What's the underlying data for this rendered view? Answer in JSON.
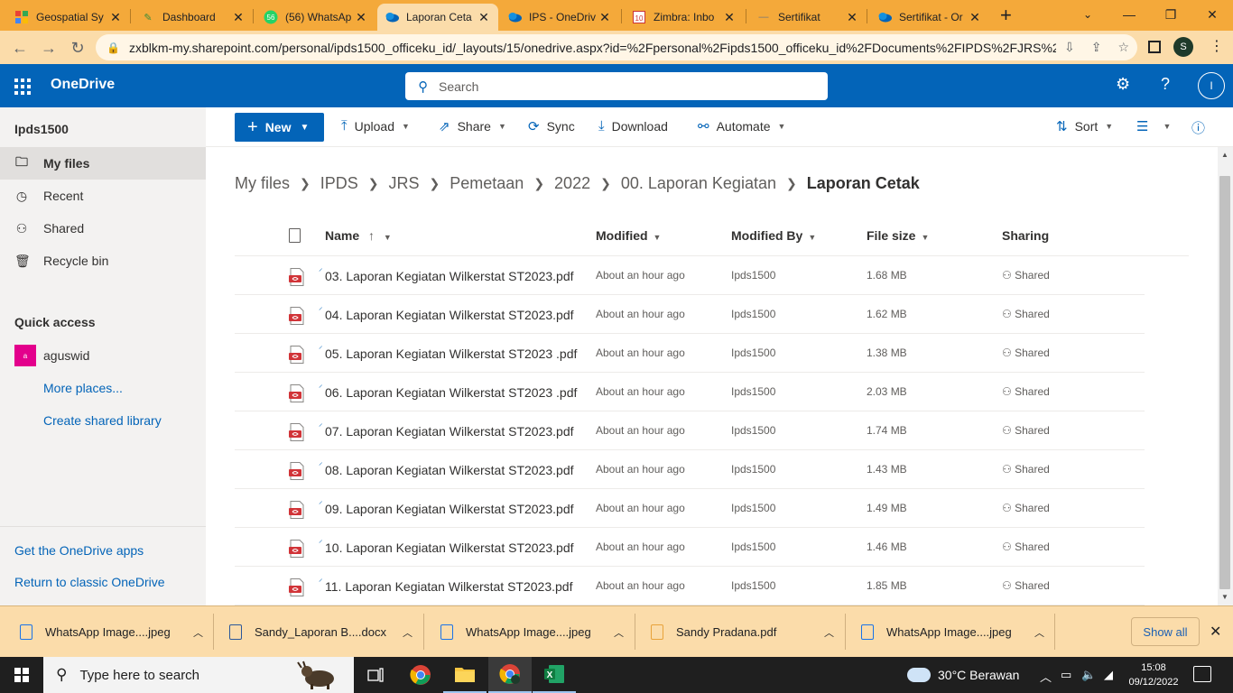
{
  "browser": {
    "tabs": [
      {
        "title": "Geospatial Sy",
        "icon": "geospatial-favicon"
      },
      {
        "title": "Dashboard",
        "icon": "dashboard-favicon"
      },
      {
        "title": "(56) WhatsAp",
        "icon": "whatsapp-favicon",
        "badge": "56"
      },
      {
        "title": "Laporan Ceta",
        "icon": "onedrive-favicon",
        "active": true
      },
      {
        "title": "IPS - OneDriv",
        "icon": "onedrive-favicon"
      },
      {
        "title": "Zimbra: Inbo",
        "icon": "zimbra-favicon"
      },
      {
        "title": "Sertifikat",
        "icon": "blank-favicon"
      },
      {
        "title": "Sertifikat - Or",
        "icon": "onedrive-favicon"
      }
    ],
    "url": "zxblkm-my.sharepoint.com/personal/ipds1500_officeku_id/_layouts/15/onedrive.aspx?id=%2Fpersonal%2Fipds1500_officeku_id%2FDocuments%2FIPDS%2FJRS%2...",
    "profile_initial": "S"
  },
  "suite": {
    "app_name": "OneDrive",
    "search_placeholder": "Search",
    "user_initial": "I"
  },
  "leftnav": {
    "account": "Ipds1500",
    "items": [
      {
        "label": "My files",
        "icon": "folder-icon",
        "selected": true
      },
      {
        "label": "Recent",
        "icon": "clock-icon"
      },
      {
        "label": "Shared",
        "icon": "people-icon"
      },
      {
        "label": "Recycle bin",
        "icon": "recycle-bin-icon"
      }
    ],
    "quick_access_title": "Quick access",
    "quick_access_user": "aguswid",
    "quick_access_avatar": "a",
    "more_places": "More places...",
    "create_library": "Create shared library",
    "get_apps": "Get the OneDrive apps",
    "return_classic": "Return to classic OneDrive"
  },
  "commands": {
    "new": "New",
    "upload": "Upload",
    "share": "Share",
    "sync": "Sync",
    "download": "Download",
    "automate": "Automate",
    "sort": "Sort"
  },
  "breadcrumb": [
    "My files",
    "IPDS",
    "JRS",
    "Pemetaan",
    "2022",
    "00. Laporan Kegiatan",
    "Laporan Cetak"
  ],
  "columns": {
    "name": "Name",
    "name_sort": "↑",
    "modified": "Modified",
    "modified_by": "Modified By",
    "file_size": "File size",
    "sharing": "Sharing"
  },
  "files": [
    {
      "name": "03. Laporan Kegiatan Wilkerstat ST2023.pdf",
      "modified": "About an hour ago",
      "modified_by": "Ipds1500",
      "size": "1.68 MB",
      "sharing": "Shared"
    },
    {
      "name": "04. Laporan Kegiatan Wilkerstat ST2023.pdf",
      "modified": "About an hour ago",
      "modified_by": "Ipds1500",
      "size": "1.62 MB",
      "sharing": "Shared"
    },
    {
      "name": "05. Laporan Kegiatan Wilkerstat ST2023 .pdf",
      "modified": "About an hour ago",
      "modified_by": "Ipds1500",
      "size": "1.38 MB",
      "sharing": "Shared"
    },
    {
      "name": "06. Laporan Kegiatan Wilkerstat ST2023 .pdf",
      "modified": "About an hour ago",
      "modified_by": "Ipds1500",
      "size": "2.03 MB",
      "sharing": "Shared"
    },
    {
      "name": "07. Laporan Kegiatan Wilkerstat ST2023.pdf",
      "modified": "About an hour ago",
      "modified_by": "Ipds1500",
      "size": "1.74 MB",
      "sharing": "Shared"
    },
    {
      "name": "08. Laporan Kegiatan Wilkerstat ST2023.pdf",
      "modified": "About an hour ago",
      "modified_by": "Ipds1500",
      "size": "1.43 MB",
      "sharing": "Shared"
    },
    {
      "name": "09. Laporan Kegiatan Wilkerstat ST2023.pdf",
      "modified": "About an hour ago",
      "modified_by": "Ipds1500",
      "size": "1.49 MB",
      "sharing": "Shared"
    },
    {
      "name": "10. Laporan Kegiatan Wilkerstat ST2023.pdf",
      "modified": "About an hour ago",
      "modified_by": "Ipds1500",
      "size": "1.46 MB",
      "sharing": "Shared"
    },
    {
      "name": "11. Laporan Kegiatan Wilkerstat ST2023.pdf",
      "modified": "About an hour ago",
      "modified_by": "Ipds1500",
      "size": "1.85 MB",
      "sharing": "Shared"
    }
  ],
  "downloads": [
    {
      "name": "WhatsApp Image....jpeg",
      "type": "image"
    },
    {
      "name": "Sandy_Laporan B....docx",
      "type": "doc"
    },
    {
      "name": "WhatsApp Image....jpeg",
      "type": "image"
    },
    {
      "name": "Sandy Pradana.pdf",
      "type": "pdf"
    },
    {
      "name": "WhatsApp Image....jpeg",
      "type": "image"
    }
  ],
  "downloads_show_all": "Show all",
  "taskbar": {
    "search_placeholder": "Type here to search",
    "weather": "30°C  Berawan",
    "time": "15:08",
    "date": "09/12/2022"
  },
  "colors": {
    "onedrive_blue": "#0364b8",
    "chrome_frame": "#f4a93a",
    "pdf_red": "#d13438"
  }
}
